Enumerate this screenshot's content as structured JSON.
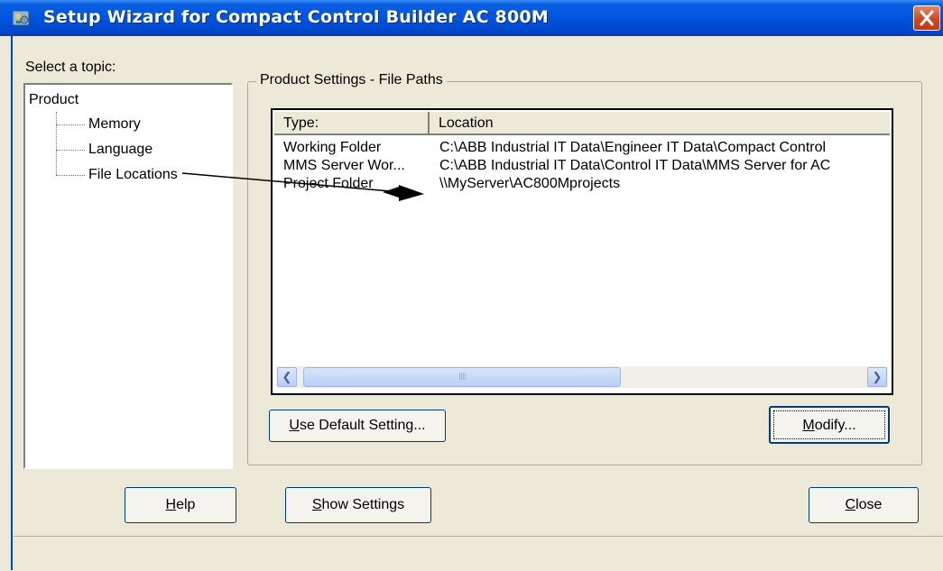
{
  "window": {
    "title": "Setup Wizard for Compact Control Builder AC 800M",
    "icon": "wizard-app-icon"
  },
  "topics": {
    "label": "Select a topic:",
    "tree": {
      "root": "Product",
      "children": [
        "Memory",
        "Language",
        "File Locations"
      ]
    }
  },
  "group": {
    "title": "Product Settings - File Paths"
  },
  "table": {
    "columns": [
      "Type:",
      "Location"
    ],
    "rows": [
      {
        "type": "Working Folder",
        "location": "C:\\ABB Industrial IT Data\\Engineer IT Data\\Compact Control"
      },
      {
        "type": "MMS Server Wor...",
        "location": "C:\\ABB Industrial IT Data\\Control IT Data\\MMS Server for AC"
      },
      {
        "type": "Project Folder",
        "location": "\\\\MyServer\\AC800Mprojects"
      }
    ],
    "scrollbar_grip": "IIII"
  },
  "buttons": {
    "use_default": {
      "mnemonic": "U",
      "rest": "se Default Setting..."
    },
    "modify": {
      "mnemonic": "M",
      "rest": "odify..."
    },
    "help": {
      "mnemonic": "H",
      "rest": "elp"
    },
    "show_settings": {
      "mnemonic": "S",
      "rest": "how Settings"
    },
    "close": {
      "mnemonic": "C",
      "rest": "lose"
    }
  },
  "colors": {
    "titlebar": "#0053e0",
    "dialog_bg": "#ece9d8",
    "close_button": "#d0471f"
  }
}
